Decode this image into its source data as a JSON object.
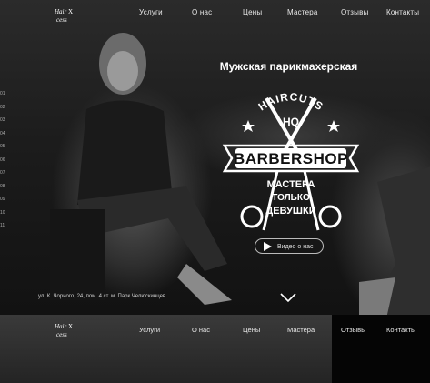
{
  "nav": {
    "items": [
      {
        "label": "Услуги"
      },
      {
        "label": "О нас"
      },
      {
        "label": "Цены"
      },
      {
        "label": "Мастера"
      },
      {
        "label": "Отзывы"
      },
      {
        "label": "Контакты"
      }
    ]
  },
  "logo": {
    "icon": "hair-xcess-logo"
  },
  "hero": {
    "headline": "Мужская парикмахерская",
    "badge": {
      "top": "HAIRCUTS",
      "hq": "HQ",
      "main": "BARBERSHOP",
      "line1": "МАСТЕРА",
      "line2": "ТОЛЬКО",
      "line3": "ДЕВУШКИ"
    },
    "video_button": "Видео о нас",
    "address": "ул. К. Чорного, 24, пом. 4 ст. м. Парк Челюскинцев",
    "counter": [
      "01",
      "02",
      "03",
      "04",
      "05",
      "06",
      "07",
      "08",
      "09",
      "10",
      "11"
    ]
  },
  "bottom_nav": {
    "items": [
      {
        "label": "Услуги"
      },
      {
        "label": "О нас"
      },
      {
        "label": "Цены"
      },
      {
        "label": "Мастера"
      },
      {
        "label": "Отзывы"
      },
      {
        "label": "Контакты"
      }
    ]
  },
  "colors": {
    "background": "#0d0d0d",
    "text": "#ffffff"
  }
}
